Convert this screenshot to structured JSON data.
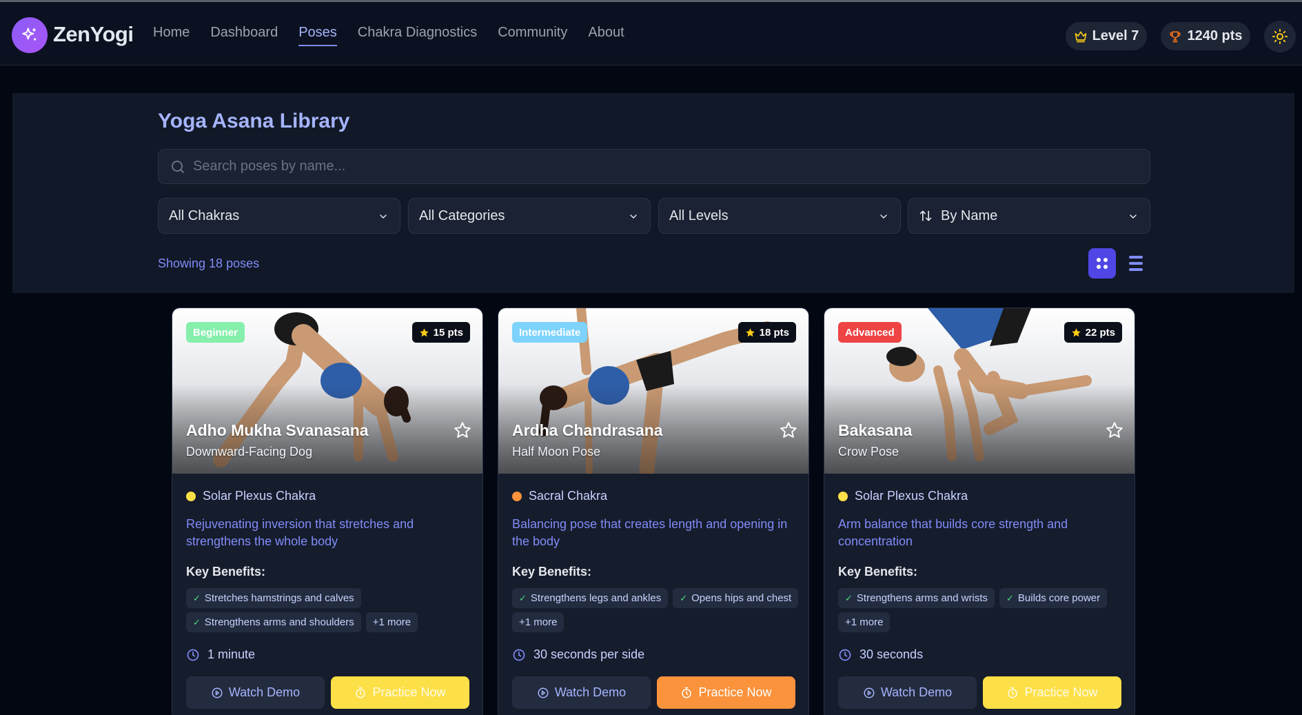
{
  "brand": {
    "name": "ZenYogi"
  },
  "nav": {
    "links": [
      {
        "label": "Home",
        "active": false
      },
      {
        "label": "Dashboard",
        "active": false
      },
      {
        "label": "Poses",
        "active": true
      },
      {
        "label": "Chakra Diagnostics",
        "active": false
      },
      {
        "label": "Community",
        "active": false
      },
      {
        "label": "About",
        "active": false
      }
    ],
    "level_label": "Level 7",
    "points_label": "1240 pts"
  },
  "library": {
    "title": "Yoga Asana Library",
    "search_placeholder": "Search poses by name...",
    "filters": {
      "chakra": "All Chakras",
      "category": "All Categories",
      "level": "All Levels",
      "sort": "By Name"
    },
    "showing": "Showing 18 poses",
    "view_mode": "grid"
  },
  "cards": [
    {
      "level": "Beginner",
      "level_color": "#86efac",
      "points": "15 pts",
      "sanskrit": "Adho Mukha Svanasana",
      "english": "Downward-Facing Dog",
      "chakra": "Solar Plexus Chakra",
      "chakra_color": "#fde047",
      "description": "Rejuvenating inversion that stretches and strengthens the whole body",
      "benefits_heading": "Key Benefits:",
      "benefits": [
        "Stretches hamstrings and calves",
        "Strengthens arms and shoulders"
      ],
      "more": "+1 more",
      "duration": "1 minute",
      "demo_label": "Watch Demo",
      "practice_label": "Practice Now",
      "practice_color": "#fde047",
      "practice_text_color": "#fffbeb"
    },
    {
      "level": "Intermediate",
      "level_color": "#7dd3fc",
      "points": "18 pts",
      "sanskrit": "Ardha Chandrasana",
      "english": "Half Moon Pose",
      "chakra": "Sacral Chakra",
      "chakra_color": "#fb923c",
      "description": "Balancing pose that creates length and opening in the body",
      "benefits_heading": "Key Benefits:",
      "benefits": [
        "Strengthens legs and ankles",
        "Opens hips and chest"
      ],
      "more": "+1 more",
      "duration": "30 seconds per side",
      "demo_label": "Watch Demo",
      "practice_label": "Practice Now",
      "practice_color": "#fb923c",
      "practice_text_color": "#ffffff"
    },
    {
      "level": "Advanced",
      "level_color": "#ef4444",
      "points": "22 pts",
      "sanskrit": "Bakasana",
      "english": "Crow Pose",
      "chakra": "Solar Plexus Chakra",
      "chakra_color": "#fde047",
      "description": "Arm balance that builds core strength and concentration",
      "benefits_heading": "Key Benefits:",
      "benefits": [
        "Strengthens arms and wrists",
        "Builds core power"
      ],
      "more": "+1 more",
      "duration": "30 seconds",
      "demo_label": "Watch Demo",
      "practice_label": "Practice Now",
      "practice_color": "#fde047",
      "practice_text_color": "#fffbeb"
    }
  ]
}
